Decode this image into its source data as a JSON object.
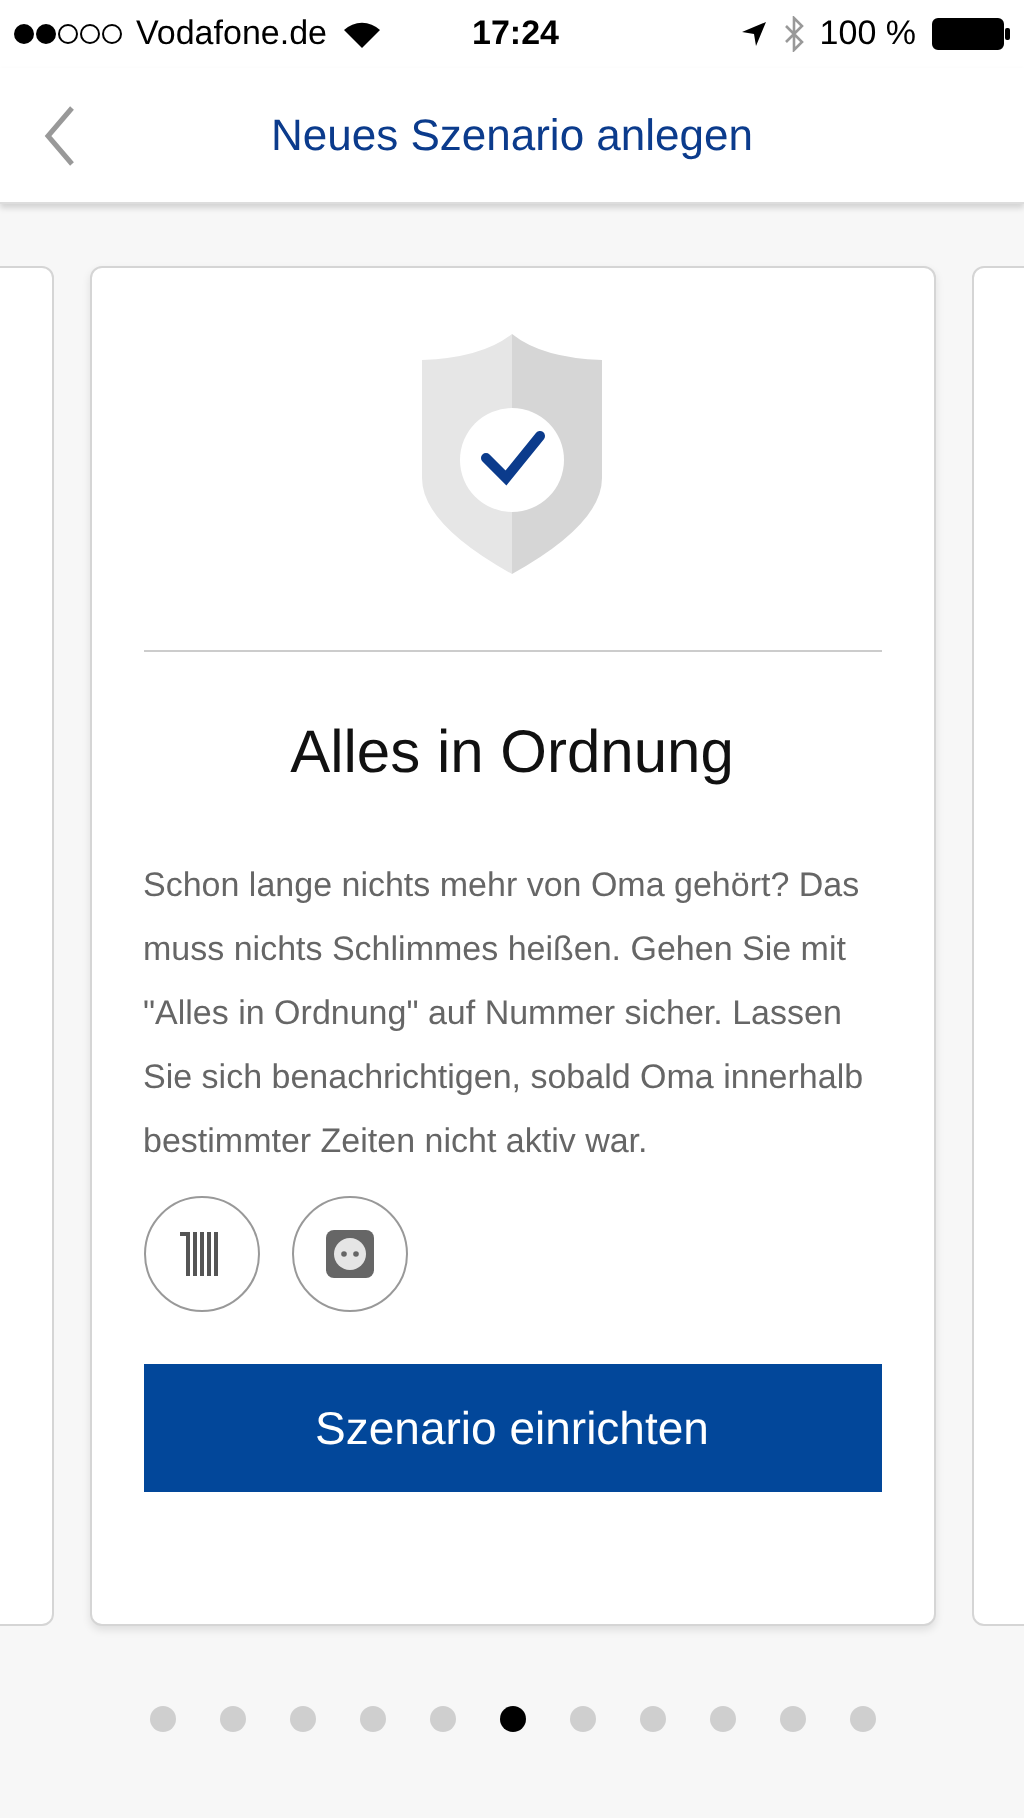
{
  "status_bar": {
    "carrier": "Vodafone.de",
    "time": "17:24",
    "battery": "100 %"
  },
  "nav": {
    "title": "Neues Szenario anlegen"
  },
  "card": {
    "title": "Alles in Ordnung",
    "description": "Schon lange nichts mehr von Oma gehört? Das muss nichts Schlimmes heißen. Gehen Sie mit \"Alles in Ordnung\" auf Nummer sicher. Lassen Sie sich benachrichtigen, sobald Oma innerhalb bestimmter Zeiten nicht aktiv war.",
    "devices": [
      {
        "kind": "radiator"
      },
      {
        "kind": "socket"
      }
    ],
    "button": "Szenario einrichten"
  },
  "pages": [
    {
      "selected": false
    },
    {
      "selected": false
    },
    {
      "selected": false
    },
    {
      "selected": false
    },
    {
      "selected": false
    },
    {
      "selected": true
    },
    {
      "selected": false
    },
    {
      "selected": false
    },
    {
      "selected": false
    },
    {
      "selected": false
    },
    {
      "selected": false
    }
  ]
}
